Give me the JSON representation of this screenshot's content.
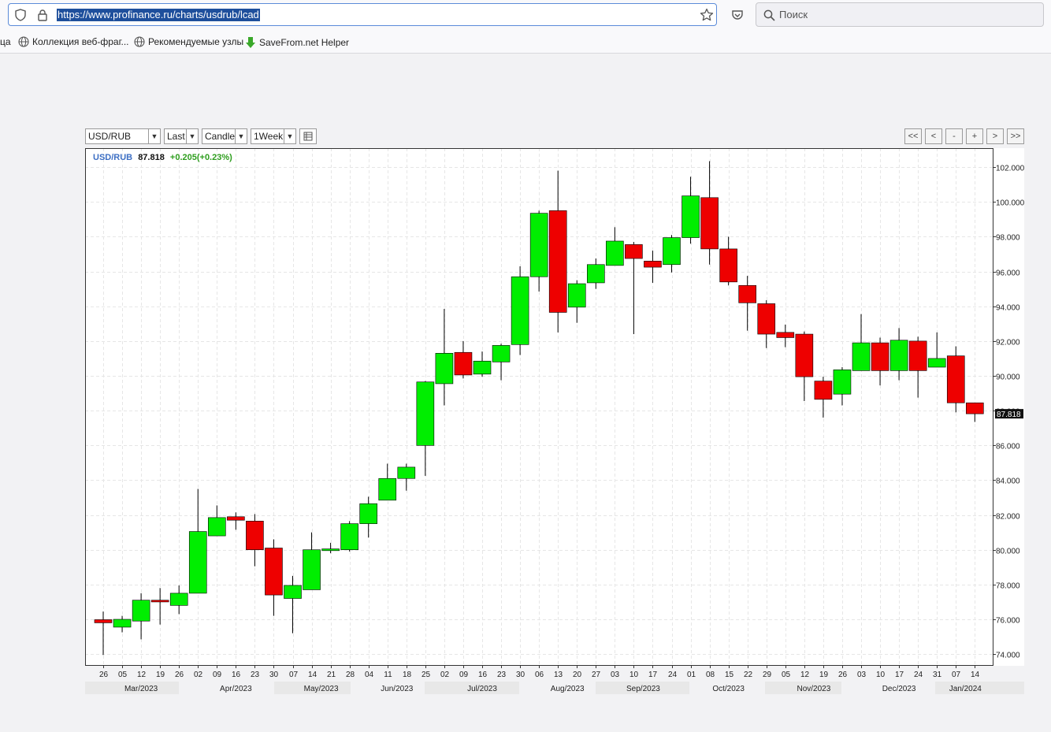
{
  "browser": {
    "url": "https://www.profinance.ru/charts/usdrub/lcad",
    "search_placeholder": "Поиск",
    "bookmarks": [
      "ца",
      "Коллекция веб-фраг...",
      "Рекомендуемые узлы",
      "SaveFrom.net Helper"
    ]
  },
  "controls": {
    "symbol": "USD/RUB",
    "price_type": "Last",
    "chart_type": "Candle",
    "period": "1Week",
    "nav": [
      "<<",
      "<",
      "-",
      "+",
      ">",
      ">>"
    ]
  },
  "header": {
    "symbol": "USD/RUB",
    "last": "87.818",
    "change": "+0.205(+0.23%)"
  },
  "colors": {
    "up": "#00ee00",
    "down": "#ee0000",
    "symbol_text": "#3d6fc4",
    "change_text": "#2e9e1e",
    "grid": "#e6e6e6",
    "month_band": "#e8e8e8"
  },
  "chart_data": {
    "type": "candlestick",
    "title": "USD/RUB",
    "ylim": [
      73,
      103
    ],
    "y_ticks": [
      "74.000",
      "76.000",
      "78.000",
      "80.000",
      "82.000",
      "84.000",
      "86.000",
      "88.000",
      "90.000",
      "92.000",
      "94.000",
      "96.000",
      "98.000",
      "100.000",
      "102.000"
    ],
    "last_price_label": "87.818",
    "months": [
      "Mar/2023",
      "Apr/2023",
      "May/2023",
      "Jun/2023",
      "Jul/2023",
      "Aug/2023",
      "Sep/2023",
      "Oct/2023",
      "Nov/2023",
      "Dec/2023",
      "Jan/2024"
    ],
    "candles": [
      {
        "x": "26",
        "open": 75.98,
        "high": 76.45,
        "low": 73.95,
        "close": 75.8
      },
      {
        "x": "05",
        "open": 75.55,
        "high": 76.2,
        "low": 75.25,
        "close": 76.0
      },
      {
        "x": "12",
        "open": 75.9,
        "high": 77.5,
        "low": 74.85,
        "close": 77.1
      },
      {
        "x": "19",
        "open": 77.1,
        "high": 77.8,
        "low": 75.7,
        "close": 77.0
      },
      {
        "x": "26",
        "open": 76.8,
        "high": 77.95,
        "low": 76.3,
        "close": 77.5
      },
      {
        "x": "02",
        "open": 77.5,
        "high": 83.5,
        "low": 77.5,
        "close": 81.05
      },
      {
        "x": "09",
        "open": 80.8,
        "high": 82.55,
        "low": 80.8,
        "close": 81.85
      },
      {
        "x": "16",
        "open": 81.9,
        "high": 82.15,
        "low": 81.15,
        "close": 81.7
      },
      {
        "x": "23",
        "open": 81.65,
        "high": 82.05,
        "low": 79.05,
        "close": 80.0
      },
      {
        "x": "30",
        "open": 80.1,
        "high": 80.6,
        "low": 76.2,
        "close": 77.4
      },
      {
        "x": "07",
        "open": 77.2,
        "high": 78.5,
        "low": 75.2,
        "close": 77.95
      },
      {
        "x": "14",
        "open": 77.7,
        "high": 81.0,
        "low": 77.7,
        "close": 80.0
      },
      {
        "x": "21",
        "open": 79.95,
        "high": 80.4,
        "low": 79.8,
        "close": 80.05
      },
      {
        "x": "28",
        "open": 80.0,
        "high": 81.65,
        "low": 79.9,
        "close": 81.5
      },
      {
        "x": "04",
        "open": 81.5,
        "high": 83.05,
        "low": 80.7,
        "close": 82.65
      },
      {
        "x": "11",
        "open": 82.85,
        "high": 84.95,
        "low": 82.85,
        "close": 84.1
      },
      {
        "x": "18",
        "open": 84.1,
        "high": 84.95,
        "low": 83.4,
        "close": 84.75
      },
      {
        "x": "25",
        "open": 86.0,
        "high": 89.7,
        "low": 84.25,
        "close": 89.65
      },
      {
        "x": "02",
        "open": 89.55,
        "high": 93.85,
        "low": 88.3,
        "close": 91.3
      },
      {
        "x": "09",
        "open": 91.35,
        "high": 92.0,
        "low": 89.85,
        "close": 90.05
      },
      {
        "x": "16",
        "open": 90.1,
        "high": 91.4,
        "low": 89.95,
        "close": 90.85
      },
      {
        "x": "23",
        "open": 90.8,
        "high": 91.85,
        "low": 89.75,
        "close": 91.75
      },
      {
        "x": "30",
        "open": 91.8,
        "high": 96.3,
        "low": 91.2,
        "close": 95.7
      },
      {
        "x": "06",
        "open": 95.7,
        "high": 99.5,
        "low": 94.85,
        "close": 99.35
      },
      {
        "x": "13",
        "open": 99.5,
        "high": 101.8,
        "low": 92.5,
        "close": 93.65
      },
      {
        "x": "20",
        "open": 93.95,
        "high": 95.5,
        "low": 93.05,
        "close": 95.3
      },
      {
        "x": "27",
        "open": 95.35,
        "high": 96.75,
        "low": 95.0,
        "close": 96.4
      },
      {
        "x": "03",
        "open": 96.35,
        "high": 98.55,
        "low": 96.35,
        "close": 97.75
      },
      {
        "x": "10",
        "open": 97.55,
        "high": 97.7,
        "low": 92.4,
        "close": 96.75
      },
      {
        "x": "17",
        "open": 96.6,
        "high": 97.2,
        "low": 95.35,
        "close": 96.25
      },
      {
        "x": "24",
        "open": 96.4,
        "high": 98.1,
        "low": 95.95,
        "close": 97.95
      },
      {
        "x": "01",
        "open": 97.95,
        "high": 101.45,
        "low": 97.6,
        "close": 100.35
      },
      {
        "x": "08",
        "open": 100.25,
        "high": 102.35,
        "low": 96.4,
        "close": 97.3
      },
      {
        "x": "15",
        "open": 97.3,
        "high": 98.0,
        "low": 95.2,
        "close": 95.4
      },
      {
        "x": "22",
        "open": 95.2,
        "high": 95.75,
        "low": 92.6,
        "close": 94.2
      },
      {
        "x": "29",
        "open": 94.15,
        "high": 94.35,
        "low": 91.6,
        "close": 92.4
      },
      {
        "x": "05",
        "open": 92.5,
        "high": 92.95,
        "low": 91.65,
        "close": 92.2
      },
      {
        "x": "12",
        "open": 92.4,
        "high": 92.55,
        "low": 88.55,
        "close": 89.95
      },
      {
        "x": "19",
        "open": 89.7,
        "high": 89.95,
        "low": 87.6,
        "close": 88.65
      },
      {
        "x": "26",
        "open": 88.95,
        "high": 90.5,
        "low": 88.3,
        "close": 90.35
      },
      {
        "x": "03",
        "open": 90.3,
        "high": 93.55,
        "low": 90.3,
        "close": 91.9
      },
      {
        "x": "10",
        "open": 91.9,
        "high": 92.2,
        "low": 89.45,
        "close": 90.3
      },
      {
        "x": "17",
        "open": 90.3,
        "high": 92.75,
        "low": 89.75,
        "close": 92.05
      },
      {
        "x": "24",
        "open": 92.0,
        "high": 92.25,
        "low": 88.75,
        "close": 90.3
      },
      {
        "x": "31",
        "open": 90.5,
        "high": 92.5,
        "low": 90.5,
        "close": 91.0
      },
      {
        "x": "07",
        "open": 91.15,
        "high": 91.7,
        "low": 87.9,
        "close": 88.45
      },
      {
        "x": "14",
        "open": 88.45,
        "high": 88.45,
        "low": 87.35,
        "close": 87.82
      }
    ]
  }
}
